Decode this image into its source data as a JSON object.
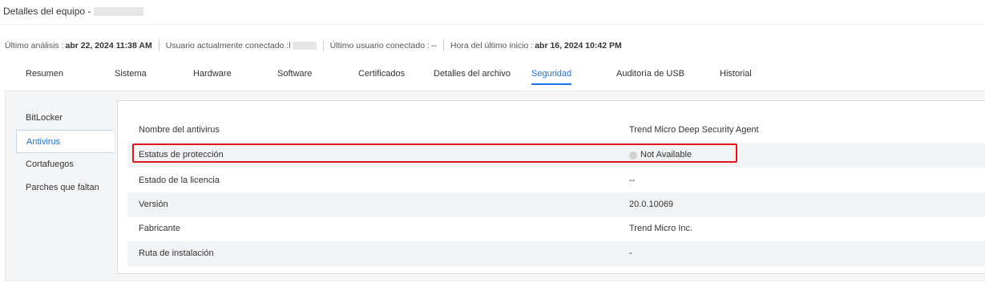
{
  "header": {
    "title": "Detalles del equipo -"
  },
  "info_bar": {
    "last_scan_label": "Último análisis :",
    "last_scan_value": "abr 22, 2024 11:38 AM",
    "current_user_label": "Usuario actualmente conectado :",
    "current_user_value": "l",
    "last_user_label": "Último usuario conectado :",
    "last_user_value": "--",
    "last_boot_label": "Hora del último inicio :",
    "last_boot_value": "abr 16, 2024 10:42 PM"
  },
  "tabs": [
    {
      "label": "Resumen"
    },
    {
      "label": "Sistema"
    },
    {
      "label": "Hardware"
    },
    {
      "label": "Software"
    },
    {
      "label": "Certificados"
    },
    {
      "label": "Detalles del archivo"
    },
    {
      "label": "Seguridad",
      "active": true
    },
    {
      "label": "Auditoría de USB"
    },
    {
      "label": "Historial"
    }
  ],
  "sidebar": {
    "items": [
      {
        "label": "BitLocker"
      },
      {
        "label": "Antivirus",
        "active": true
      },
      {
        "label": "Cortafuegos"
      },
      {
        "label": "Parches que faltan"
      }
    ]
  },
  "antivirus": {
    "rows": [
      {
        "label": "Nombre del antivirus",
        "value": "Trend Micro Deep Security Agent"
      },
      {
        "label": "Estatus de protección",
        "value": "Not Available",
        "status_icon": "gray-dot-icon"
      },
      {
        "label": "Estado de la licencia",
        "value": "--"
      },
      {
        "label": "Versión",
        "value": "20.0.10069"
      },
      {
        "label": "Fabricante",
        "value": "Trend Micro Inc."
      },
      {
        "label": "Ruta de instalación",
        "value": "-"
      }
    ]
  },
  "colors": {
    "accent": "#1a73e8",
    "highlight": "#e0141e",
    "panel_bg": "#f4f5f7",
    "row_alt": "#f2f3f5"
  }
}
